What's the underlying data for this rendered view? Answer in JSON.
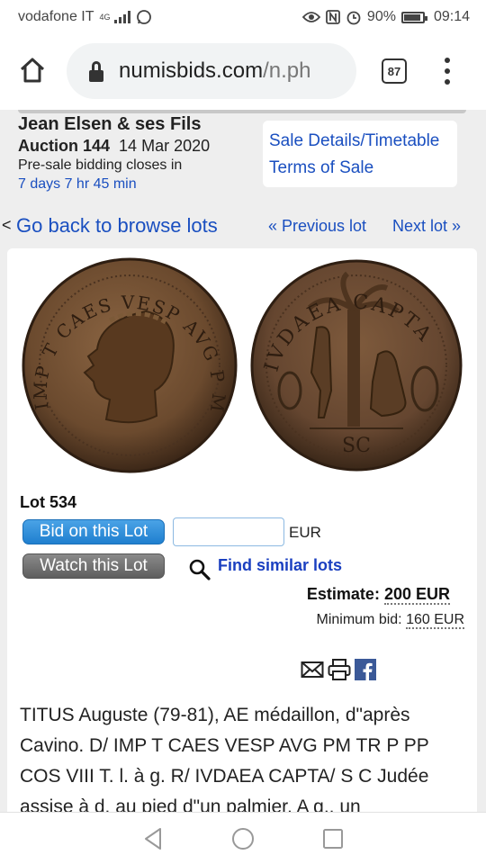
{
  "status": {
    "carrier": "vodafone IT",
    "network": "4G",
    "battery": "90%",
    "battery_level": 0.9,
    "time": "09:14"
  },
  "browser": {
    "url_domain": "numisbids.com",
    "url_path": "/n.ph",
    "tab_count": "87"
  },
  "auction": {
    "house": "Jean Elsen & ses Fils",
    "auction_label": "Auction 144",
    "date": "14 Mar 2020",
    "closes_label": "Pre-sale bidding closes in",
    "countdown": "7 days 7 hr 45 min"
  },
  "sale_links": {
    "details": "Sale Details/Timetable",
    "terms": "Terms of Sale"
  },
  "nav": {
    "back_prefix": "<",
    "back": "Go back to browse lots",
    "previous": "« Previous lot",
    "next": "Next lot »"
  },
  "lot": {
    "number": "Lot 534",
    "bid_button": "Bid on this Lot",
    "bid_value": "",
    "currency": "EUR",
    "watch_button": "Watch this Lot",
    "find_similar": "Find similar lots",
    "estimate_label": "Estimate:",
    "estimate_value": "200 EUR",
    "minbid_label": "Minimum bid:",
    "minbid_value": "160 EUR",
    "obverse_legend": "IMP T CAES VESP AVG P M TR P P P COS VIII",
    "reverse_legend": "IVDAEA CAPTA",
    "reverse_exergue": "SC",
    "description": "TITUS Auguste (79-81), AE médaillon, d\"après Cavino. D/ IMP T CAES VESP AVG PM TR P PP COS VIII T. l. à g. R/ IVDAEA CAPTA/ S C Judée assise à d. au pied d\"un palmier. A g., un"
  },
  "colors": {
    "link": "#1a4fc0",
    "bid_button": "#2b8ad8",
    "watch_button": "#6e6e6e",
    "page_bg": "#eeeeee",
    "coin_bronze": "#6b4a2e"
  },
  "icons": [
    "home-icon",
    "lock-icon",
    "tabs-icon",
    "menu-icon",
    "search-icon",
    "email-icon",
    "print-icon",
    "facebook-icon",
    "back-nav-icon",
    "home-nav-icon",
    "recents-nav-icon"
  ]
}
